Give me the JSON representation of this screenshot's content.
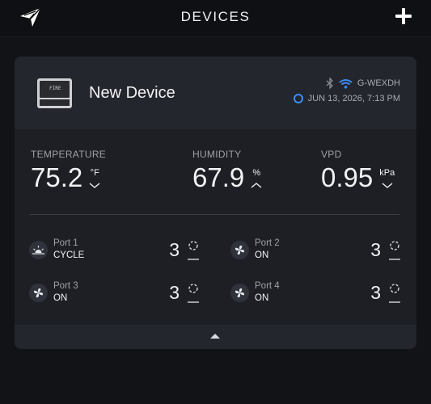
{
  "header": {
    "title": "DEVICES"
  },
  "device": {
    "name": "New Device",
    "screen_text": "FIRE",
    "network_name": "G-WEXDH",
    "timestamp": "JUN 13, 2026, 7:13 PM"
  },
  "metrics": [
    {
      "label": "TEMPERATURE",
      "value": "75.2",
      "unit": "°F",
      "trend": "down"
    },
    {
      "label": "HUMIDITY",
      "value": "67.9",
      "unit": "%",
      "trend": "up"
    },
    {
      "label": "VPD",
      "value": "0.95",
      "unit": "kPa",
      "trend": "down"
    }
  ],
  "ports": [
    {
      "name": "Port 1",
      "mode": "CYCLE",
      "level": "3",
      "icon": "sunrise-icon"
    },
    {
      "name": "Port 2",
      "mode": "ON",
      "level": "3",
      "icon": "fan-icon"
    },
    {
      "name": "Port 3",
      "mode": "ON",
      "level": "3",
      "icon": "fan-icon"
    },
    {
      "name": "Port 4",
      "mode": "ON",
      "level": "3",
      "icon": "fan-icon"
    }
  ],
  "colors": {
    "accent": "#3d8cf2",
    "background": "#121317",
    "card": "#1d1f25"
  }
}
